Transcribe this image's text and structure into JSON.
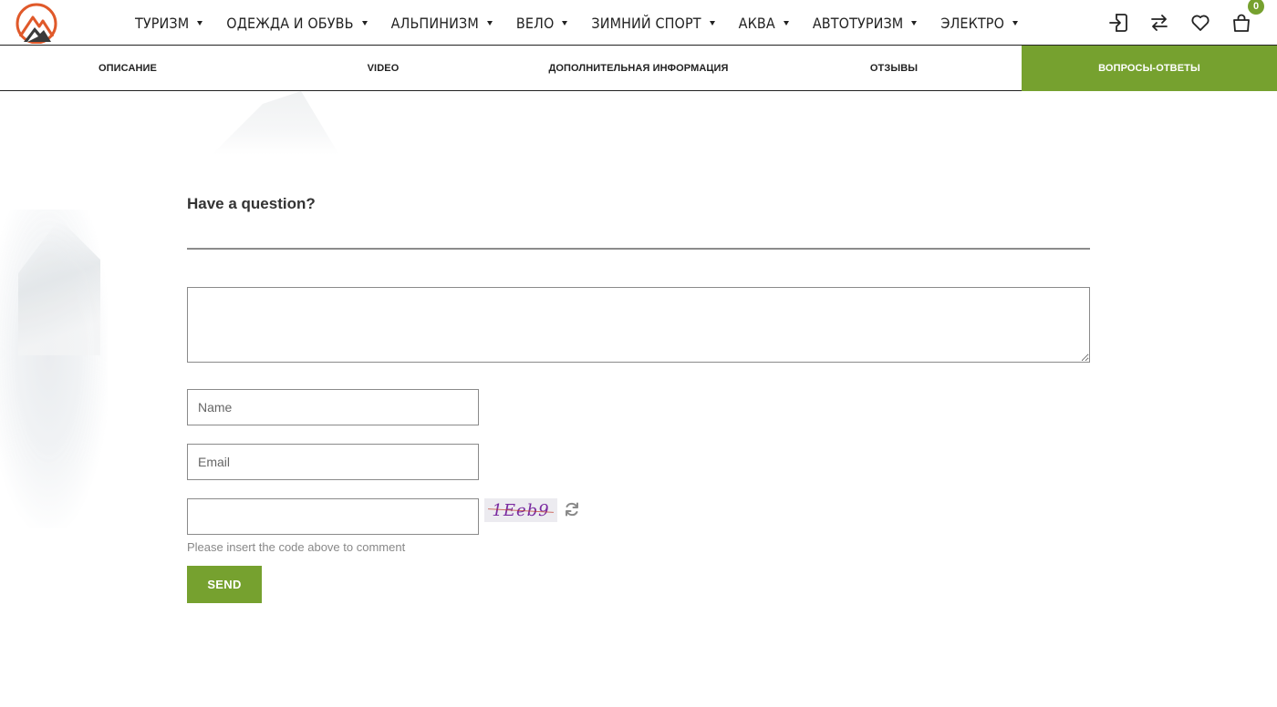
{
  "brand": {
    "logo_icon": "mountain-logo-icon",
    "accent": "#76a12f",
    "logo_color": "#e0592a"
  },
  "nav": {
    "items": [
      {
        "label": "ТУРИЗМ"
      },
      {
        "label": "ОДЕЖДА И ОБУВЬ"
      },
      {
        "label": "АЛЬПИНИЗМ"
      },
      {
        "label": "ВЕЛО"
      },
      {
        "label": "ЗИМНИЙ СПОРТ"
      },
      {
        "label": "АКВА"
      },
      {
        "label": "АВТОТУРИЗМ"
      },
      {
        "label": "ЭЛЕКТРО"
      }
    ]
  },
  "header_icons": {
    "login": "login-icon",
    "compare": "compare-arrows-icon",
    "wishlist": "heart-icon",
    "cart": "shopping-bag-icon",
    "cart_count": "0"
  },
  "tabs": [
    {
      "label": "ОПИСАНИЕ",
      "active": false
    },
    {
      "label": "VIDEO",
      "active": false
    },
    {
      "label": "ДОПОЛНИТЕЛЬНАЯ ИНФОРМАЦИЯ",
      "active": false
    },
    {
      "label": "ОТЗЫВЫ",
      "active": false
    },
    {
      "label": "ВОПРОСЫ-ОТВЕТЫ",
      "active": true
    }
  ],
  "form": {
    "title": "Have a question?",
    "question_value": "",
    "name_placeholder": "Name",
    "email_placeholder": "Email",
    "captcha_value": "",
    "captcha_code": "1Eeb9",
    "captcha_hint": "Please insert the code above to comment",
    "send_label": "SEND"
  }
}
